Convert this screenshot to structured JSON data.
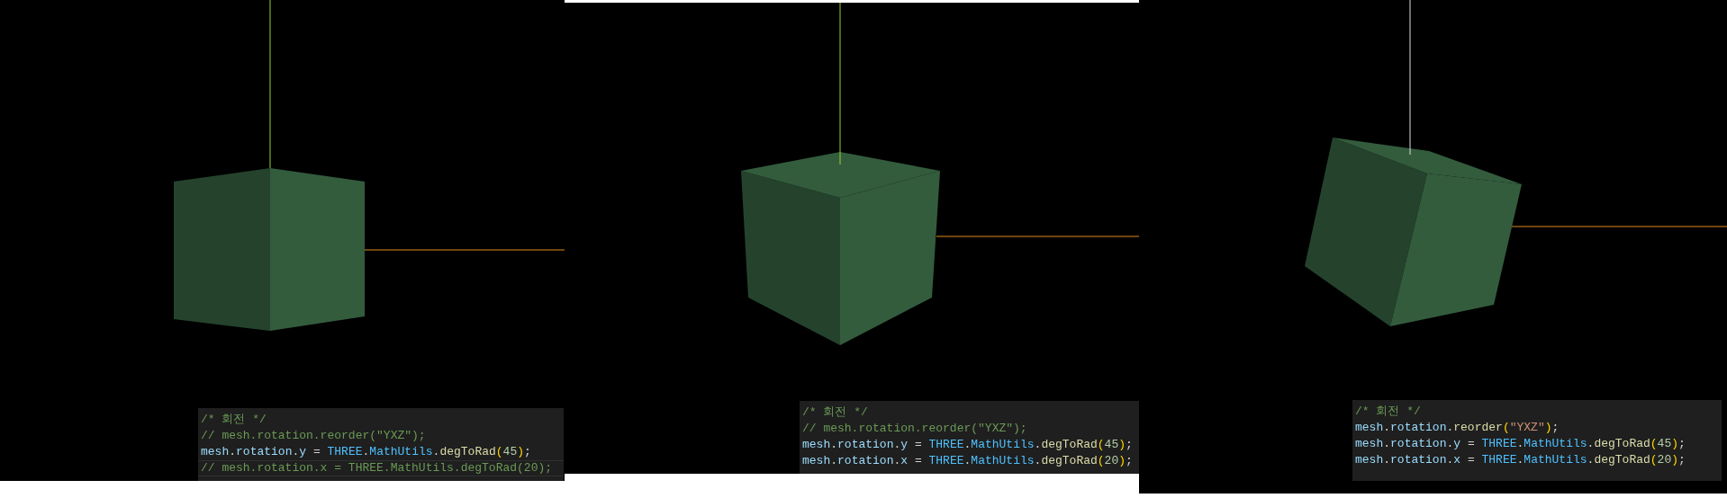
{
  "panels": [
    {
      "code_lines": [
        {
          "text": "/* 회전 */",
          "kind": "comment",
          "current": false
        },
        {
          "text": "// mesh.rotation.reorder(\"YXZ\");",
          "kind": "comment",
          "current": false
        },
        {
          "text": "mesh.rotation.y = THREE.MathUtils.degToRad(45);",
          "kind": "code",
          "current": false
        },
        {
          "text": "// mesh.rotation.x = THREE.MathUtils.degToRad(20);",
          "kind": "comment",
          "current": true
        }
      ]
    },
    {
      "code_lines": [
        {
          "text": "/* 회전 */",
          "kind": "comment",
          "current": false
        },
        {
          "text": "// mesh.rotation.reorder(\"YXZ\");",
          "kind": "comment",
          "current": false
        },
        {
          "text": "mesh.rotation.y = THREE.MathUtils.degToRad(45);",
          "kind": "code",
          "current": false
        },
        {
          "text": "mesh.rotation.x = THREE.MathUtils.degToRad(20);",
          "kind": "code",
          "current": false
        }
      ]
    },
    {
      "code_lines": [
        {
          "text": "/* 회전 */",
          "kind": "comment",
          "current": false
        },
        {
          "text": "mesh.rotation.reorder(\"YXZ\");",
          "kind": "code",
          "current": false
        },
        {
          "text": "mesh.rotation.y = THREE.MathUtils.degToRad(45);",
          "kind": "code",
          "current": false
        },
        {
          "text": "mesh.rotation.x = THREE.MathUtils.degToRad(20);",
          "kind": "code",
          "current": false
        }
      ]
    }
  ]
}
